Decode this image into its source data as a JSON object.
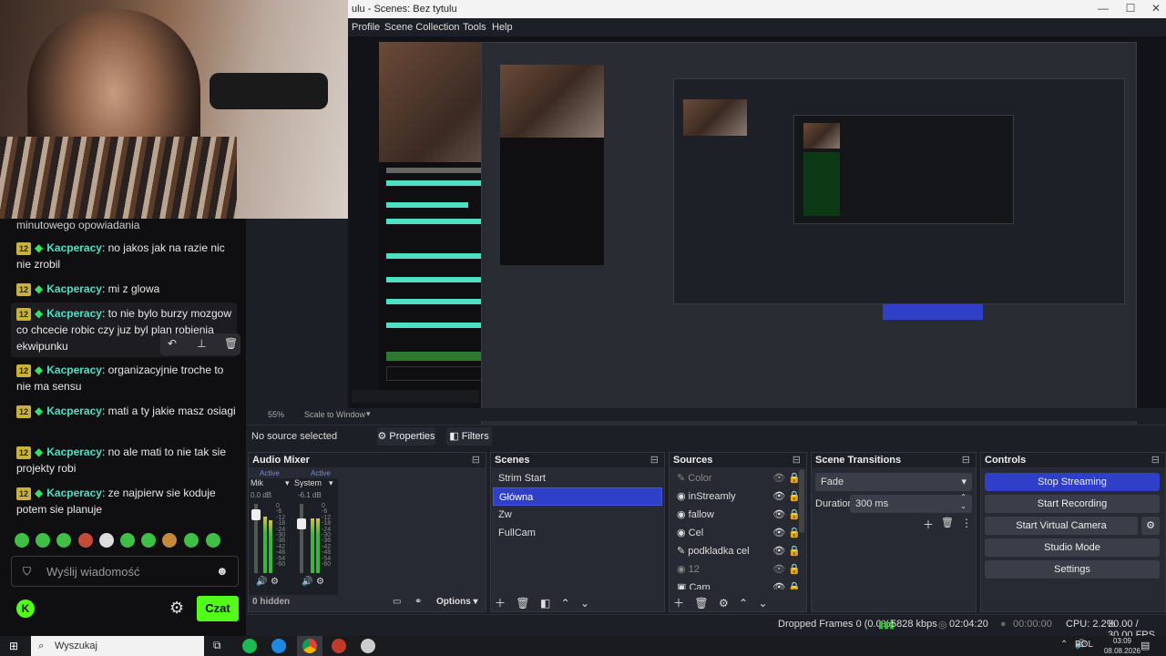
{
  "obs": {
    "window_title": "ulu - Scenes: Bez tytulu",
    "window_controls": {
      "minimize": "—",
      "maximize": "☐",
      "close": "✕"
    },
    "menu": [
      "Profile",
      "Scene Collection",
      "Tools",
      "Help"
    ],
    "zoom": "55%",
    "scale_mode": "Scale to Window",
    "source_status": "No source selected",
    "properties_label": "Properties",
    "filters_label": "Filters",
    "audio_mixer": {
      "title": "Audio Mixer",
      "channels": [
        {
          "name": "Mik",
          "status": "Active",
          "db": "0.0 dB"
        },
        {
          "name": "System",
          "status": "Active",
          "db": "-6.1 dB"
        }
      ],
      "scale": [
        "0",
        "-6",
        "-12",
        "-18",
        "-24",
        "-30",
        "-36",
        "-42",
        "-48",
        "-54",
        "-60"
      ],
      "hidden": "0 hidden",
      "options": "Options"
    },
    "scenes": {
      "title": "Scenes",
      "items": [
        "Strim Start",
        "Główna",
        "Zw",
        "FullCam"
      ],
      "selected": 1
    },
    "sources": {
      "title": "Sources",
      "items": [
        {
          "name": "Color",
          "icon": "brush-icon",
          "dim": true
        },
        {
          "name": "inStreamly",
          "icon": "globe-icon",
          "dim": false
        },
        {
          "name": "fallow",
          "icon": "globe-icon",
          "dim": false
        },
        {
          "name": "Cel",
          "icon": "globe-icon",
          "dim": false
        },
        {
          "name": "podkladka cel",
          "icon": "brush-icon",
          "dim": false
        },
        {
          "name": "12",
          "icon": "globe-icon",
          "dim": true
        },
        {
          "name": "Cam",
          "icon": "camera-icon",
          "dim": false
        }
      ]
    },
    "transitions": {
      "title": "Scene Transitions",
      "type": "Fade",
      "duration_label": "Duration",
      "duration": "300 ms"
    },
    "controls": {
      "title": "Controls",
      "stop_streaming": "Stop Streaming",
      "start_recording": "Start Recording",
      "start_virtual_camera": "Start Virtual Camera",
      "studio_mode": "Studio Mode",
      "settings": "Settings"
    },
    "status": {
      "dropped": "Dropped Frames 0 (0.0%)",
      "bitrate": "5828 kbps",
      "stream_time": "02:04:20",
      "rec_time": "00:00:00",
      "cpu": "CPU: 2.2%",
      "fps": "30.00 / 30.00 FPS"
    }
  },
  "chat": {
    "partial_top": "minutowego opowiadania",
    "messages": [
      {
        "badge": "12",
        "user": "Kacperacy",
        "text": ": no jakos jak na razie nic nie zrobil"
      },
      {
        "badge": "12",
        "user": "Kacperacy",
        "text": ": mi z glowa"
      },
      {
        "badge": "12",
        "user": "Kacperacy",
        "text": ": to nie bylo burzy mozgow co chcecie robic czy juz byl plan robienia ekwipunku"
      },
      {
        "badge": "12",
        "user": "Kacperacy",
        "text": ": organizacyjnie troche to nie ma sensu"
      },
      {
        "badge": "12",
        "user": "Kacperacy",
        "text": ": mati a ty jakie masz osiagi"
      },
      {
        "badge": "12",
        "user": "Kacperacy",
        "text": ": no ale mati to nie tak sie projekty robi"
      },
      {
        "badge": "12",
        "user": "Kacperacy",
        "text": ": ze najpierw sie koduje potem sie planuje"
      }
    ],
    "input_placeholder": "Wyślij wiadomość",
    "send_label": "Czat",
    "accent": "#53fc18"
  },
  "taskbar": {
    "search_placeholder": "Wyszukaj",
    "language": "POL",
    "time": "03:09",
    "date": "08.08.2026"
  },
  "colors": {
    "obs_bg": "#1d1f26",
    "obs_panel": "#272a33",
    "obs_accent": "#2f3fc8",
    "kick_green": "#53fc18",
    "username": "#4fe0c4"
  }
}
